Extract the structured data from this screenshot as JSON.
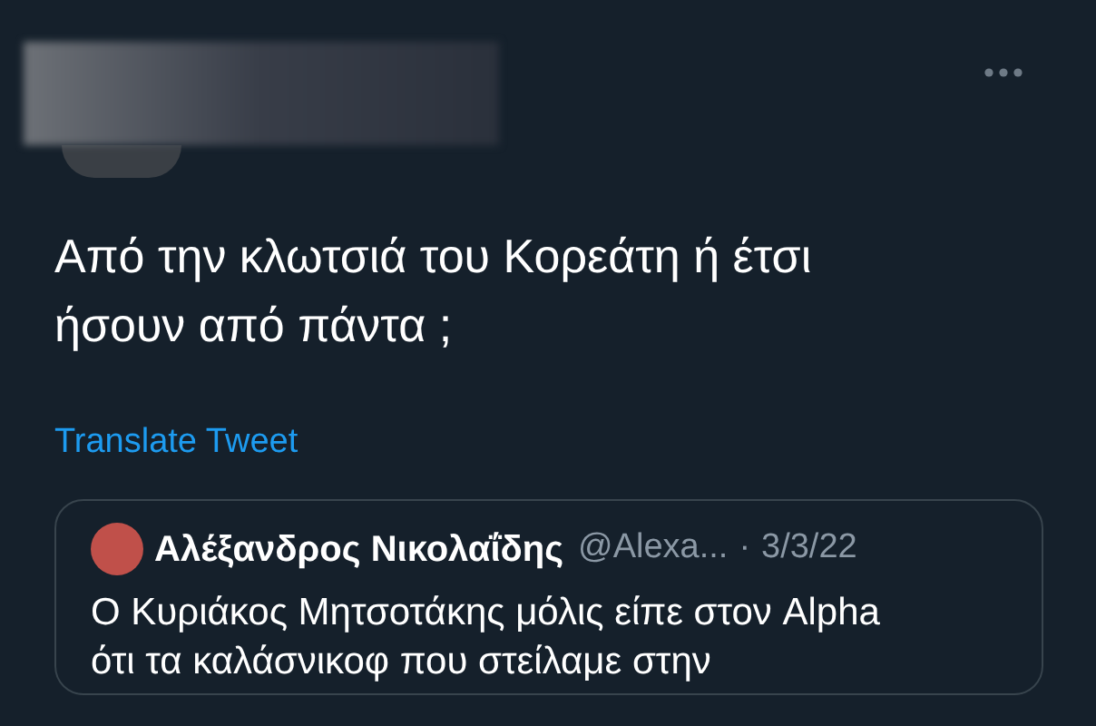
{
  "tweet": {
    "text": "Από την κλωτσιά του Κορεάτη ή έτσι ήσουν από πάντα ;",
    "translate_link": "Translate Tweet"
  },
  "quoted_tweet": {
    "name": "Αλέξανδρος Νικολαΐδης",
    "handle": "@Alexa...",
    "separator": "·",
    "date": "3/3/22",
    "text": "Ο Κυριάκος Μητσοτάκης μόλις είπε στον Alpha ότι τα καλάσνικοφ που στείλαμε στην"
  }
}
